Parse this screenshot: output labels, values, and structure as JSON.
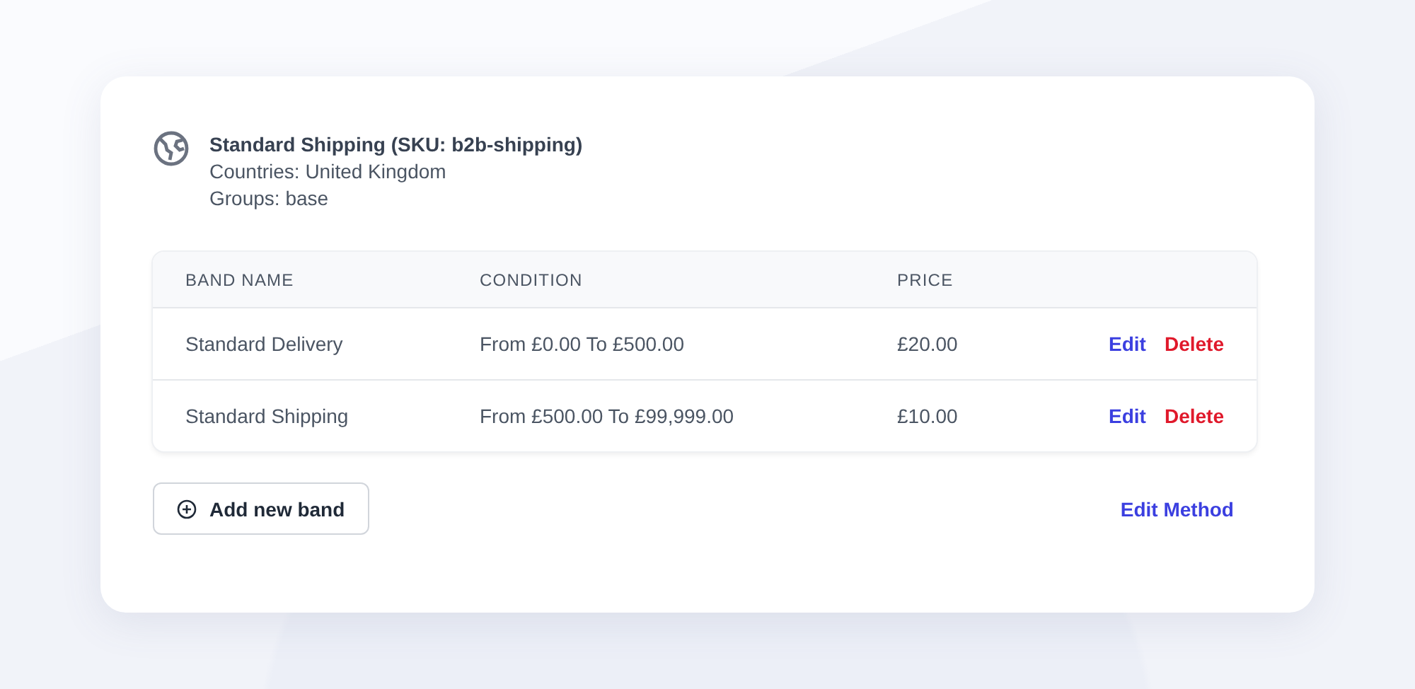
{
  "method": {
    "title": "Standard Shipping (SKU: b2b-shipping)",
    "details": [
      "Countries: United Kingdom",
      "Groups: base"
    ]
  },
  "table": {
    "columns": [
      "BAND NAME",
      "CONDITION",
      "PRICE"
    ],
    "rows": [
      {
        "band_name": "Standard Delivery",
        "condition": "From £0.00 To £500.00",
        "price": "£20.00",
        "actions": [
          "Edit",
          "Delete"
        ]
      },
      {
        "band_name": "Standard Shipping",
        "condition": "From £500.00 To £99,999.00",
        "price": "£10.00",
        "actions": [
          "Edit",
          "Delete"
        ]
      }
    ]
  },
  "add_button": "Add new band",
  "edit_method_link": "Edit Method"
}
